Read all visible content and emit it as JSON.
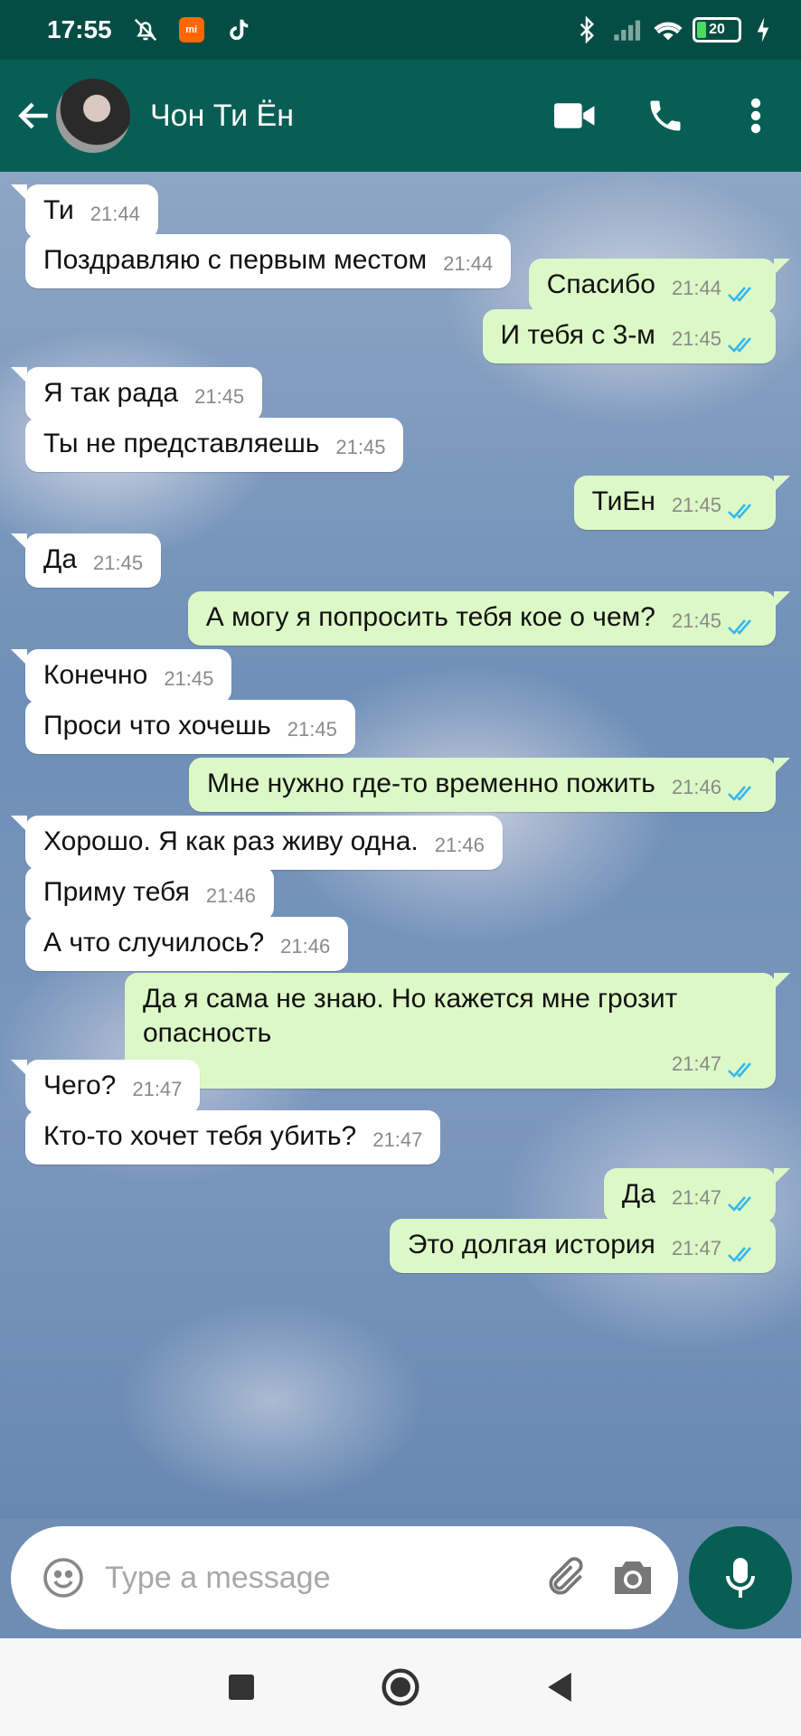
{
  "status_bar": {
    "time": "17:55",
    "mi_label": "mi",
    "battery": "20"
  },
  "header": {
    "contact_name": "Чон Ти Ён"
  },
  "messages": [
    {
      "dir": "in",
      "text": "Ти",
      "time": "21:44",
      "tail": true
    },
    {
      "dir": "in",
      "text": "Поздравляю с первым местом",
      "time": "21:44",
      "tail": false
    },
    {
      "dir": "out",
      "text": "Спасибо",
      "time": "21:44",
      "tail": true
    },
    {
      "dir": "out",
      "text": "И тебя с 3-м",
      "time": "21:45",
      "tail": false
    },
    {
      "dir": "in",
      "text": "Я так рада",
      "time": "21:45",
      "tail": true
    },
    {
      "dir": "in",
      "text": "Ты не представляешь",
      "time": "21:45",
      "tail": false
    },
    {
      "dir": "out",
      "text": "ТиЕн",
      "time": "21:45",
      "tail": true
    },
    {
      "dir": "in",
      "text": "Да",
      "time": "21:45",
      "tail": true
    },
    {
      "dir": "out",
      "text": "А могу я попросить тебя кое о чем?",
      "time": "21:45",
      "tail": true
    },
    {
      "dir": "in",
      "text": "Конечно",
      "time": "21:45",
      "tail": true
    },
    {
      "dir": "in",
      "text": "Проси что хочешь",
      "time": "21:45",
      "tail": false
    },
    {
      "dir": "out",
      "text": "Мне нужно где-то временно пожить",
      "time": "21:46",
      "tail": true
    },
    {
      "dir": "in",
      "text": "Хорошо. Я как раз живу одна.",
      "time": "21:46",
      "tail": true
    },
    {
      "dir": "in",
      "text": "Приму тебя",
      "time": "21:46",
      "tail": false
    },
    {
      "dir": "in",
      "text": "А что случилось?",
      "time": "21:46",
      "tail": false
    },
    {
      "dir": "out",
      "text": "Да я сама не знаю. Но кажется мне грозит опасность",
      "time": "21:47",
      "tail": true
    },
    {
      "dir": "in",
      "text": "Чего?",
      "time": "21:47",
      "tail": true
    },
    {
      "dir": "in",
      "text": "Кто-то хочет тебя убить?",
      "time": "21:47",
      "tail": false
    },
    {
      "dir": "out",
      "text": "Да",
      "time": "21:47",
      "tail": true
    },
    {
      "dir": "out",
      "text": "Это долгая история",
      "time": "21:47",
      "tail": false
    }
  ],
  "composer": {
    "placeholder": "Type a message"
  },
  "colors": {
    "header": "#075e54",
    "status_bar": "#054d44",
    "outgoing_bubble": "#dcf8c6",
    "incoming_bubble": "#ffffff",
    "read_ticks": "#34b7f1"
  },
  "icons": [
    "back-arrow-icon",
    "video-call-icon",
    "phone-icon",
    "more-options-icon",
    "emoji-icon",
    "attach-icon",
    "camera-icon",
    "mic-icon"
  ]
}
